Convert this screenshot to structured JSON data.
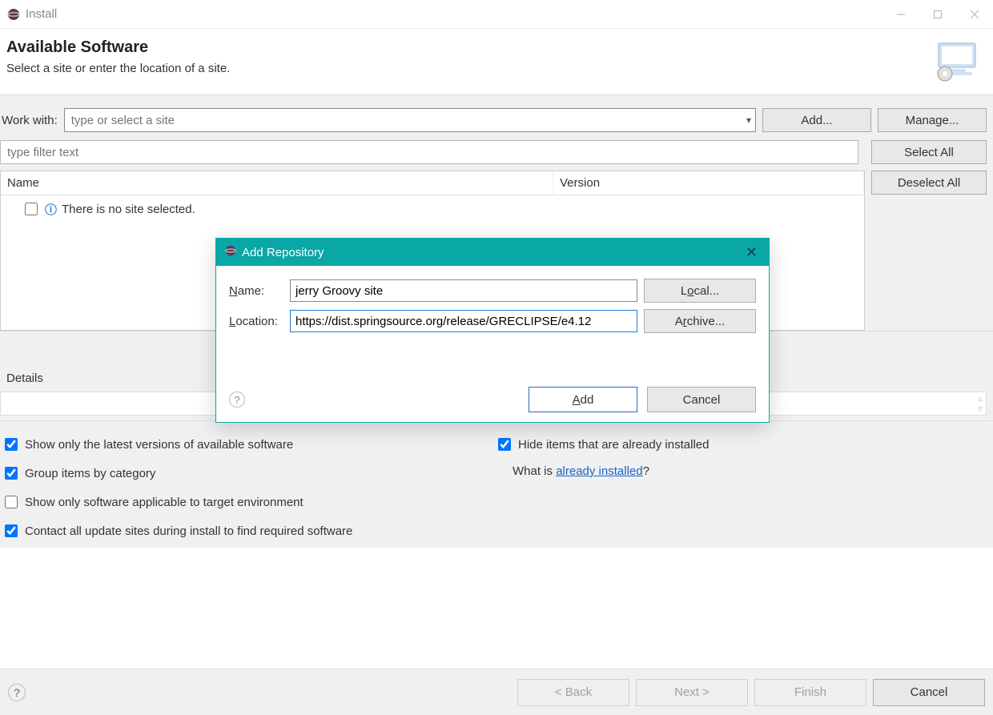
{
  "titlebar": {
    "title": "Install"
  },
  "header": {
    "heading": "Available Software",
    "subtitle": "Select a site or enter the location of a site."
  },
  "workWith": {
    "label": "Work with:",
    "placeholder": "type or select a site",
    "add": "Add...",
    "manage": "Manage..."
  },
  "filter": {
    "placeholder": "type filter text"
  },
  "sideButtons": {
    "selectAll": "Select All",
    "deselectAll": "Deselect All"
  },
  "table": {
    "columns": {
      "name": "Name",
      "version": "Version"
    },
    "emptyMessage": "There is no site selected."
  },
  "details": {
    "label": "Details"
  },
  "options": {
    "latestOnly": "Show only the latest versions of available software",
    "groupByCategory": "Group items by category",
    "applicableOnly": "Show only software applicable to target environment",
    "contactAll": "Contact all update sites during install to find required software",
    "hideInstalled": "Hide items that are already installed",
    "whatIsPrefix": "What is ",
    "alreadyInstalledLink": "already installed",
    "whatIsSuffix": "?"
  },
  "footer": {
    "back": "< Back",
    "next": "Next >",
    "finish": "Finish",
    "cancel": "Cancel"
  },
  "modal": {
    "title": "Add Repository",
    "nameLabel": "Name:",
    "nameValue": "jerry Groovy site",
    "locationLabel": "Location:",
    "locationValue": "https://dist.springsource.org/release/GRECLIPSE/e4.12",
    "localBtn": "Local...",
    "archiveBtn": "Archive...",
    "addBtn": "Add",
    "cancelBtn": "Cancel"
  }
}
